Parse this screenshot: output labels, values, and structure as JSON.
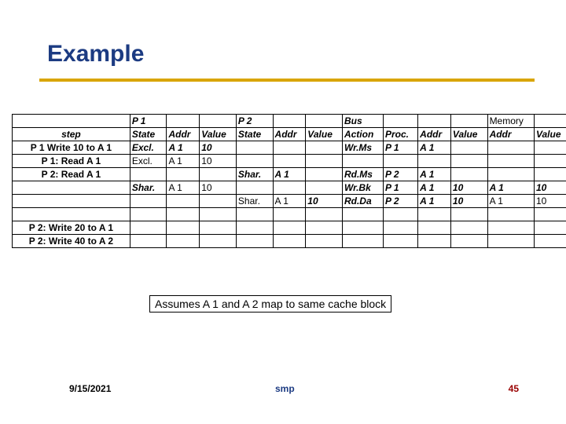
{
  "title": "Example",
  "groups": {
    "p1": "P 1",
    "p2": "P 2",
    "bus": "Bus",
    "mem": "Memory"
  },
  "headers": {
    "step": "step",
    "state": "State",
    "addr": "Addr",
    "value": "Value",
    "action": "Action",
    "proc": "Proc.",
    "maddr": "Addr",
    "mvalue": "Value"
  },
  "rows": [
    {
      "step": "P 1 Write 10 to A 1",
      "p1s": "Excl.",
      "p1a": "A 1",
      "p1v": "10",
      "p2s": "",
      "p2a": "",
      "p2v": "",
      "bact": "Wr.Ms",
      "bproc": "P 1",
      "baddr": "A 1",
      "bval": "",
      "maddr": "",
      "mval": ""
    },
    {
      "step": "P 1: Read A 1",
      "p1s": "Excl.",
      "p1a": "A 1",
      "p1v": "10",
      "p2s": "",
      "p2a": "",
      "p2v": "",
      "bact": "",
      "bproc": "",
      "baddr": "",
      "bval": "",
      "maddr": "",
      "mval": ""
    },
    {
      "step": "P 2: Read A 1",
      "p1s": "",
      "p1a": "",
      "p1v": "",
      "p2s": "Shar.",
      "p2a": "A 1",
      "p2v": "",
      "bact": "Rd.Ms",
      "bproc": "P 2",
      "baddr": "A 1",
      "bval": "",
      "maddr": "",
      "mval": ""
    },
    {
      "step": "",
      "p1s": "Shar.",
      "p1a": "A 1",
      "p1v": "10",
      "p2s": "",
      "p2a": "",
      "p2v": "",
      "bact": "Wr.Bk",
      "bproc": "P 1",
      "baddr": "A 1",
      "bval": "10",
      "maddr": "A 1",
      "mval": "10"
    },
    {
      "step": "",
      "p1s": "",
      "p1a": "",
      "p1v": "",
      "p2s": "Shar.",
      "p2a": "A 1",
      "p2v": "10",
      "bact": "Rd.Da",
      "bproc": "P 2",
      "baddr": "A 1",
      "bval": "10",
      "maddr": "A 1",
      "mval": "10"
    },
    {
      "step": "",
      "p1s": "",
      "p1a": "",
      "p1v": "",
      "p2s": "",
      "p2a": "",
      "p2v": "",
      "bact": "",
      "bproc": "",
      "baddr": "",
      "bval": "",
      "maddr": "",
      "mval": ""
    },
    {
      "step": "P 2: Write 20 to A 1",
      "p1s": "",
      "p1a": "",
      "p1v": "",
      "p2s": "",
      "p2a": "",
      "p2v": "",
      "bact": "",
      "bproc": "",
      "baddr": "",
      "bval": "",
      "maddr": "",
      "mval": ""
    },
    {
      "step": "P 2: Write 40 to A 2",
      "p1s": "",
      "p1a": "",
      "p1v": "",
      "p2s": "",
      "p2a": "",
      "p2v": "",
      "bact": "",
      "bproc": "",
      "baddr": "",
      "bval": "",
      "maddr": "",
      "mval": ""
    }
  ],
  "note": "Assumes A 1 and A 2 map to same cache block",
  "footer": {
    "date": "9/15/2021",
    "center": "smp",
    "page": "45"
  }
}
